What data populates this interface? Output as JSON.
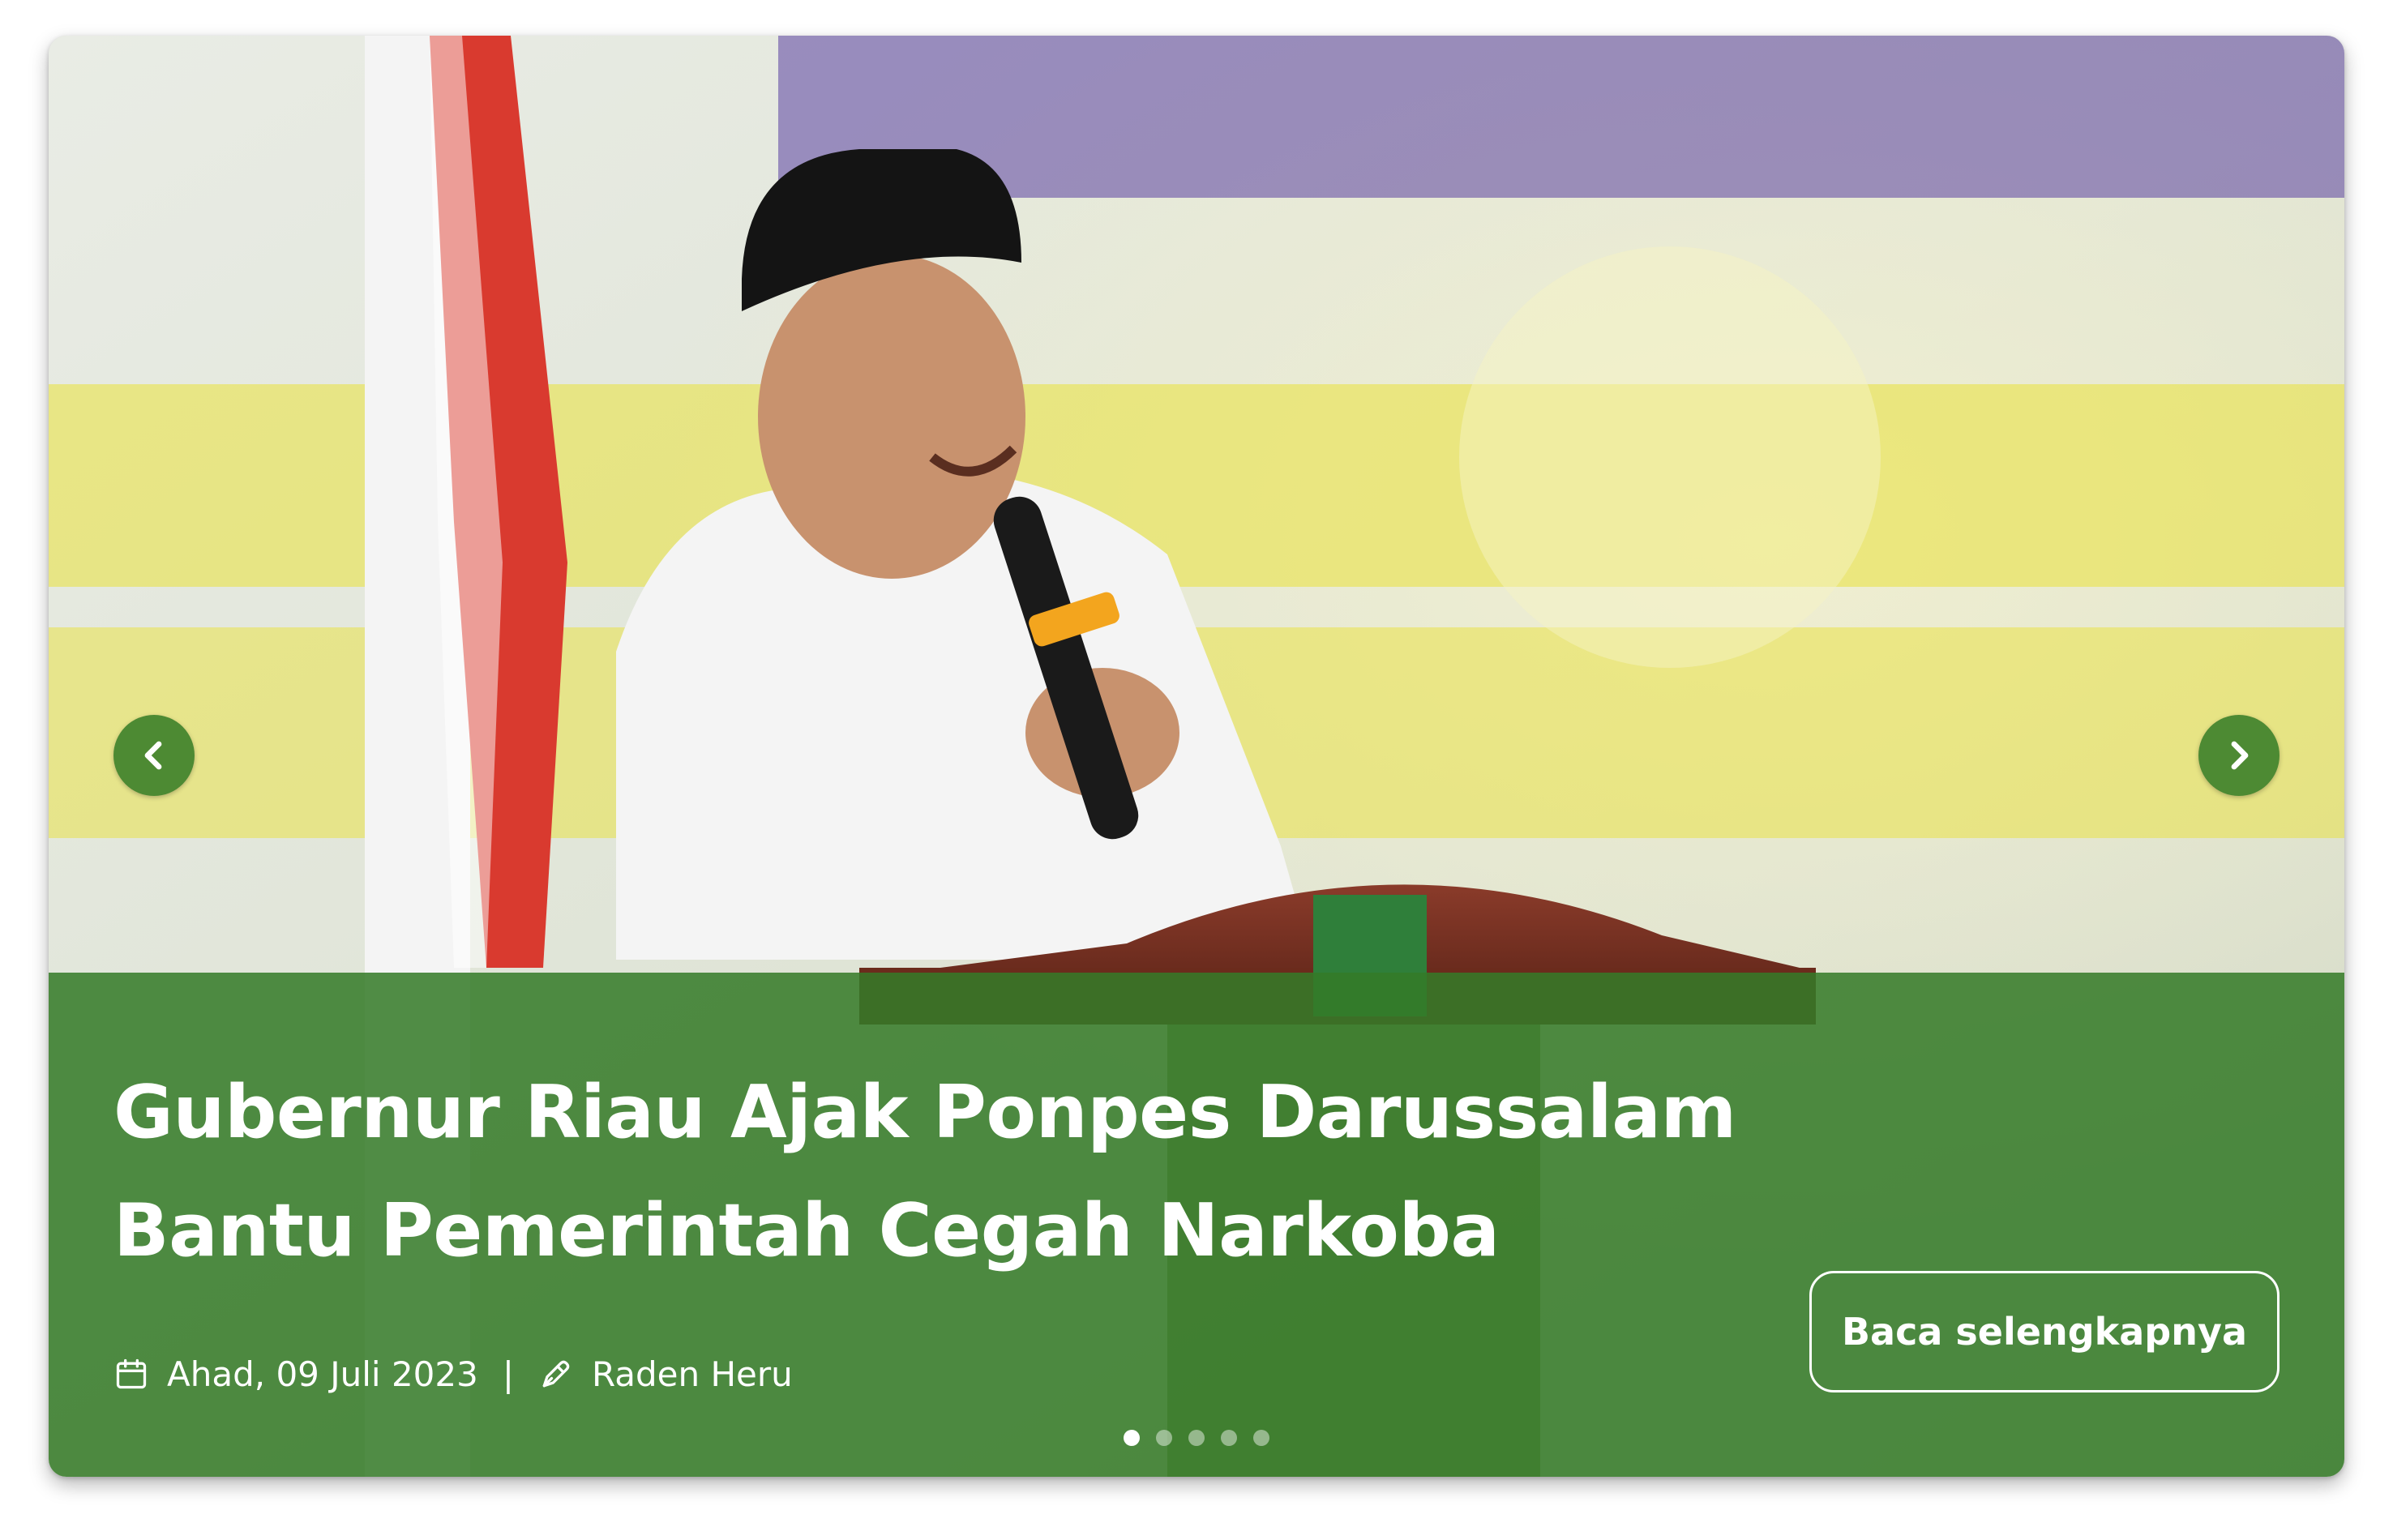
{
  "slide": {
    "headline": "Gubernur Riau Ajak Ponpes Darussalam Bantu Pemerintah Cegah Narkoba",
    "date": "Ahad, 09 Juli 2023",
    "separator": "|",
    "author": "Raden Heru",
    "read_more_label": "Baca selengkapnya",
    "active_index": 0,
    "total_slides": 5
  },
  "icons": {
    "prev": "chevron-left-icon",
    "next": "chevron-right-icon",
    "date": "calendar-icon",
    "author": "pen-icon"
  },
  "colors": {
    "overlay": "#347a28",
    "arrow_bg": "#4d8a33",
    "text": "#ffffff"
  }
}
